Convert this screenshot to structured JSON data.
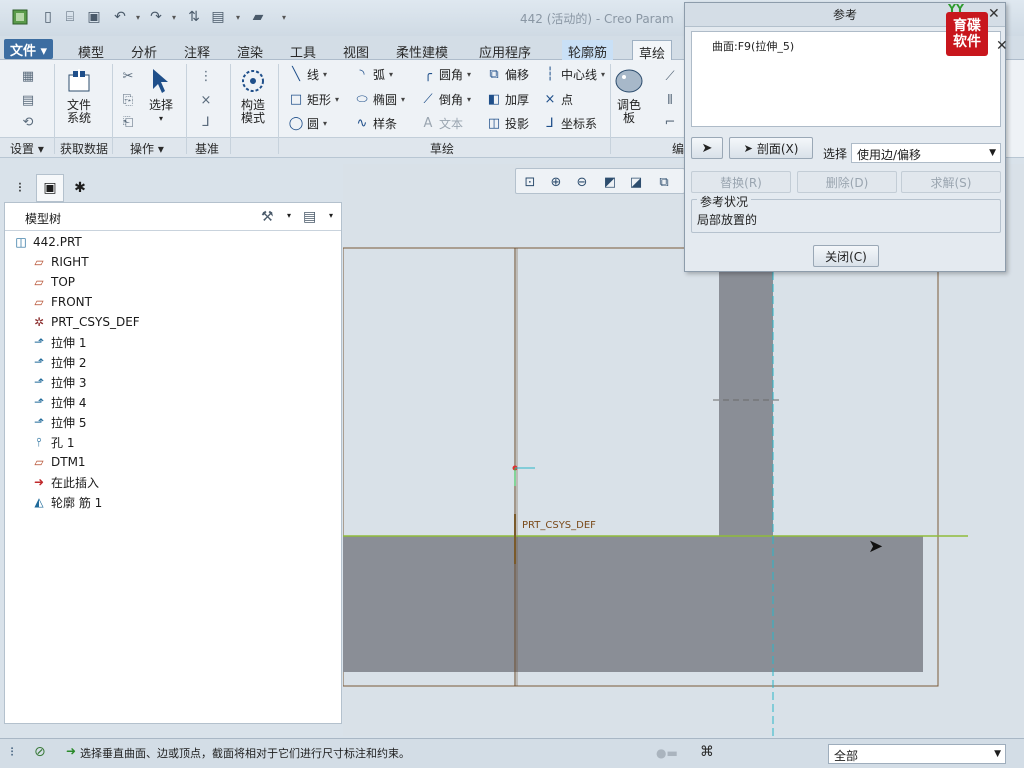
{
  "window": {
    "title": "442 (活动的) - Creo Param"
  },
  "menu_tabs": [
    {
      "label": "文件",
      "dd": "▾"
    },
    {
      "label": "模型"
    },
    {
      "label": "分析"
    },
    {
      "label": "注释"
    },
    {
      "label": "渲染"
    },
    {
      "label": "工具"
    },
    {
      "label": "视图"
    },
    {
      "label": "柔性建模"
    },
    {
      "label": "应用程序"
    },
    {
      "label": "轮廓筋"
    },
    {
      "label": "草绘"
    }
  ],
  "ribbon": {
    "file_system": {
      "line1": "文件",
      "line2": "系统"
    },
    "select": {
      "label": "选择"
    },
    "construct": {
      "line1": "构造",
      "line2": "模式"
    },
    "palette": {
      "line1": "调色",
      "line2": "板"
    },
    "sketch_tools": [
      {
        "label": "线"
      },
      {
        "label": "弧"
      },
      {
        "label": "圆角"
      },
      {
        "label": "偏移"
      },
      {
        "label": "中心线"
      },
      {
        "label": "矩形"
      },
      {
        "label": "椭圆"
      },
      {
        "label": "倒角"
      },
      {
        "label": "加厚"
      },
      {
        "label": "点"
      },
      {
        "label": "圆"
      },
      {
        "label": "样条"
      },
      {
        "label": "文本"
      },
      {
        "label": "投影"
      },
      {
        "label": "坐标系"
      }
    ],
    "groups": [
      {
        "label": "设置"
      },
      {
        "label": "获取数据"
      },
      {
        "label": "操作"
      },
      {
        "label": "基准"
      },
      {
        "label": "草绘"
      },
      {
        "label": "编"
      }
    ]
  },
  "model_tree": {
    "title": "模型树",
    "root": "442.PRT",
    "items": [
      {
        "label": "RIGHT"
      },
      {
        "label": "TOP"
      },
      {
        "label": "FRONT"
      },
      {
        "label": "PRT_CSYS_DEF"
      },
      {
        "label": "拉伸 1"
      },
      {
        "label": "拉伸 2"
      },
      {
        "label": "拉伸 3"
      },
      {
        "label": "拉伸 4"
      },
      {
        "label": "拉伸 5"
      },
      {
        "label": "孔 1"
      },
      {
        "label": "DTM1"
      },
      {
        "label": "在此插入"
      },
      {
        "label": "轮廓 筋 1"
      }
    ]
  },
  "graphics": {
    "csys_label": "PRT_CSYS_DEF"
  },
  "ref_dialog": {
    "title": "参考",
    "list_item": "曲面:F9(拉伸_5)",
    "section_button": "剖面(X)",
    "select_label": "选择",
    "select_value": "使用边/偏移",
    "replace_button": "替换(R)",
    "delete_button": "删除(D)",
    "solve_button": "求解(S)",
    "status_legend": "参考状况",
    "status_value": "局部放置的",
    "close_button": "关闭(C)"
  },
  "logo": {
    "top": "YY",
    "line1": "育碟",
    "line2": "软件"
  },
  "statusbar": {
    "message": "选择垂直曲面、边或顶点，截面将相对于它们进行尺寸标注和约束。",
    "filter_value": "全部"
  }
}
